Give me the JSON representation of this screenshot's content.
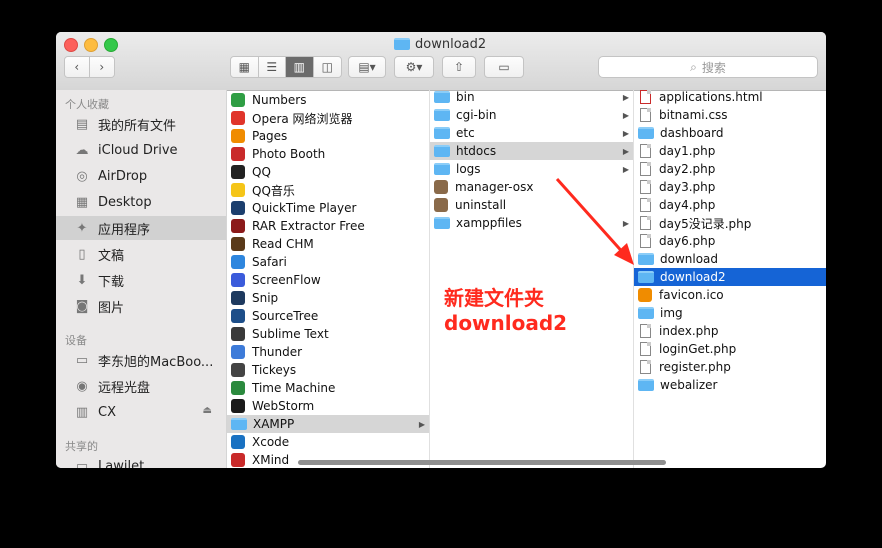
{
  "window": {
    "title": "download2"
  },
  "toolbar": {
    "search_placeholder": "搜索"
  },
  "sidebar": {
    "favorites_header": "个人收藏",
    "favorites": [
      {
        "label": "我的所有文件",
        "icon": "all-files-icon"
      },
      {
        "label": "iCloud Drive",
        "icon": "cloud-icon"
      },
      {
        "label": "AirDrop",
        "icon": "airdrop-icon"
      },
      {
        "label": "Desktop",
        "icon": "desktop-icon"
      },
      {
        "label": "应用程序",
        "icon": "applications-icon",
        "selected": true
      },
      {
        "label": "文稿",
        "icon": "documents-icon"
      },
      {
        "label": "下载",
        "icon": "downloads-icon"
      },
      {
        "label": "图片",
        "icon": "camera-icon"
      }
    ],
    "devices_header": "设备",
    "devices": [
      {
        "label": "李东旭的MacBoo...",
        "icon": "laptop-icon"
      },
      {
        "label": "远程光盘",
        "icon": "disc-icon"
      },
      {
        "label": "CX",
        "icon": "drive-icon"
      }
    ],
    "shared_header": "共享的",
    "shared": [
      {
        "label": "Lawilet",
        "icon": "network-icon"
      }
    ]
  },
  "columns": {
    "apps": [
      {
        "label": "Numbers",
        "color": "#2f9e44"
      },
      {
        "label": "Opera 网络浏览器",
        "color": "#e0352b"
      },
      {
        "label": "Pages",
        "color": "#f08c00"
      },
      {
        "label": "Photo Booth",
        "color": "#c92a2a"
      },
      {
        "label": "QQ",
        "color": "#222222"
      },
      {
        "label": "QQ音乐",
        "color": "#f5c518"
      },
      {
        "label": "QuickTime Player",
        "color": "#1c3f6e"
      },
      {
        "label": "RAR Extractor Free",
        "color": "#8b1a1a"
      },
      {
        "label": "Read CHM",
        "color": "#5a3a1a"
      },
      {
        "label": "Safari",
        "color": "#2e86de"
      },
      {
        "label": "ScreenFlow",
        "color": "#3b5bdb"
      },
      {
        "label": "Snip",
        "color": "#1e3a5f"
      },
      {
        "label": "SourceTree",
        "color": "#1d4e89"
      },
      {
        "label": "Sublime Text",
        "color": "#3a3a3a"
      },
      {
        "label": "Thunder",
        "color": "#3d7bd9"
      },
      {
        "label": "Tickeys",
        "color": "#444444"
      },
      {
        "label": "Time Machine",
        "color": "#2b8a3e"
      },
      {
        "label": "WebStorm",
        "color": "#1a1a1a"
      },
      {
        "label": "XAMPP",
        "color": "#fb8c00",
        "selected": true,
        "folder": true
      },
      {
        "label": "Xcode",
        "color": "#1971c2"
      },
      {
        "label": "XMind",
        "color": "#c92a2a"
      }
    ],
    "xampp": [
      {
        "label": "bin",
        "type": "folder-alias",
        "arrow": true
      },
      {
        "label": "cgi-bin",
        "type": "folder-alias",
        "arrow": true
      },
      {
        "label": "etc",
        "type": "folder-alias",
        "arrow": true
      },
      {
        "label": "htdocs",
        "type": "folder-alias",
        "arrow": true,
        "selected": true
      },
      {
        "label": "logs",
        "type": "folder-alias",
        "arrow": true
      },
      {
        "label": "manager-osx",
        "type": "app"
      },
      {
        "label": "uninstall",
        "type": "app"
      },
      {
        "label": "xamppfiles",
        "type": "folder-alias",
        "arrow": true
      }
    ],
    "htdocs": [
      {
        "label": "applications.html",
        "type": "html"
      },
      {
        "label": "bitnami.css",
        "type": "doc"
      },
      {
        "label": "dashboard",
        "type": "folder"
      },
      {
        "label": "day1.php",
        "type": "doc"
      },
      {
        "label": "day2.php",
        "type": "doc"
      },
      {
        "label": "day3.php",
        "type": "doc"
      },
      {
        "label": "day4.php",
        "type": "doc"
      },
      {
        "label": "day5没记录.php",
        "type": "doc"
      },
      {
        "label": "day6.php",
        "type": "doc"
      },
      {
        "label": "download",
        "type": "folder"
      },
      {
        "label": "download2",
        "type": "folder",
        "selected": true
      },
      {
        "label": "favicon.ico",
        "type": "ico"
      },
      {
        "label": "img",
        "type": "folder"
      },
      {
        "label": "index.php",
        "type": "doc"
      },
      {
        "label": "loginGet.php",
        "type": "doc"
      },
      {
        "label": "register.php",
        "type": "doc"
      },
      {
        "label": "webalizer",
        "type": "folder"
      }
    ]
  },
  "annotation": {
    "line1": "新建文件夹",
    "line2": "download2",
    "color": "#ff2a1e"
  }
}
